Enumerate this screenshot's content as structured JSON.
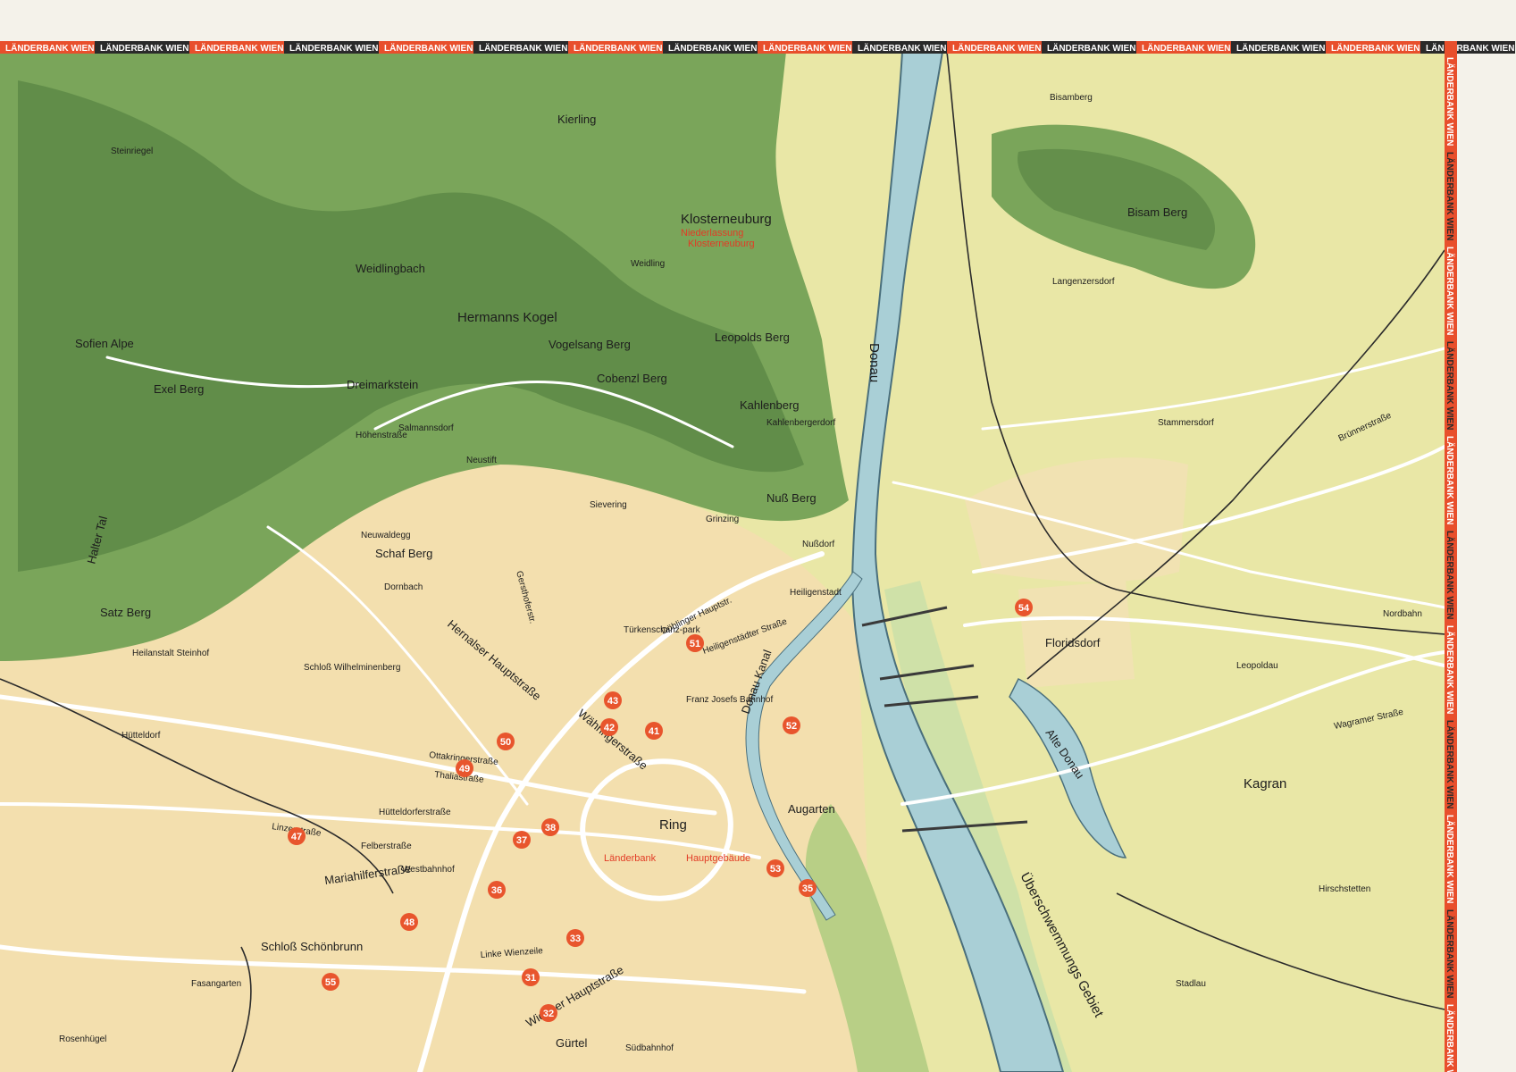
{
  "border_band": {
    "text": "LÄNDERBANK WIEN",
    "dark_color": "#2a2a2a",
    "red_color": "#e84f2c"
  },
  "colors": {
    "plain": "#e9e7a6",
    "city": "#f3dfae",
    "forest": "#7aa55a",
    "forest_dark": "#4d7a3c",
    "river": "#a9cfd6",
    "road": "#ffffff",
    "badge": "#e8552d"
  },
  "hill_labels": [
    "Kierling",
    "Steinriegel",
    "Weidlingbach",
    "Sofien Alpe",
    "Exel Berg",
    "Dreimarkstein",
    "Hermanns Kogel",
    "Vogelsang Berg",
    "Leopolds Berg",
    "Cobenzl Berg",
    "Kahlenberg",
    "Nuß Berg",
    "Schaf Berg",
    "Satz Berg",
    "Bisamberg",
    "Bisam Berg",
    "Halter Tal"
  ],
  "place_labels": [
    "Klosterneuburg",
    "Weidling",
    "Salmannsdorf",
    "Neustift",
    "Sievering",
    "Grinzing",
    "Kahlenbergerdorf",
    "Nußdorf",
    "Neuwaldegg",
    "Dornbach",
    "Heiligenstadt",
    "Türkenschanz-park",
    "Langenzersdorf",
    "Stammersdorf",
    "Floridsdorf",
    "Leopoldau",
    "Kagran",
    "Hirschstetten",
    "Stadlau",
    "Hütteldorf",
    "Schloß Schönbrunn",
    "Rosenhügel",
    "Fasangarten",
    "Schloß Wilhelminenberg",
    "Heilanstalt Steinhof",
    "Südbahnhof",
    "Westbahnhof",
    "Franz Josefs Bahnhof",
    "Augarten",
    "Nordbahn"
  ],
  "street_labels": [
    "Mariahilferstraße",
    "Gürtel",
    "Ring",
    "Währingerstraße",
    "Hernalser Hauptstraße",
    "Wagramer Straße",
    "Brünnerstraße",
    "Linke Wienzeile",
    "Wiedner Hauptstraße",
    "Heiligenstädter Straße",
    "Döblinger Hauptstr.",
    "Ottakringerstraße",
    "Thaliastraße",
    "Linzerstraße",
    "Felberstraße",
    "Höhenstraße",
    "Gersthoferstr.",
    "Hütteldorferstraße"
  ],
  "water_labels": [
    "Donau",
    "Donau Kanal",
    "Alte Donau",
    "Überschwemmungs Gebiet"
  ],
  "bank_labels": [
    "Niederlassung",
    "Klosterneuburg",
    "Länderbank",
    "Hauptgebäude"
  ],
  "badges": [
    "31",
    "32",
    "33",
    "35",
    "36",
    "37",
    "38",
    "41",
    "42",
    "43",
    "47",
    "48",
    "49",
    "50",
    "51",
    "52",
    "53",
    "54",
    "55"
  ]
}
